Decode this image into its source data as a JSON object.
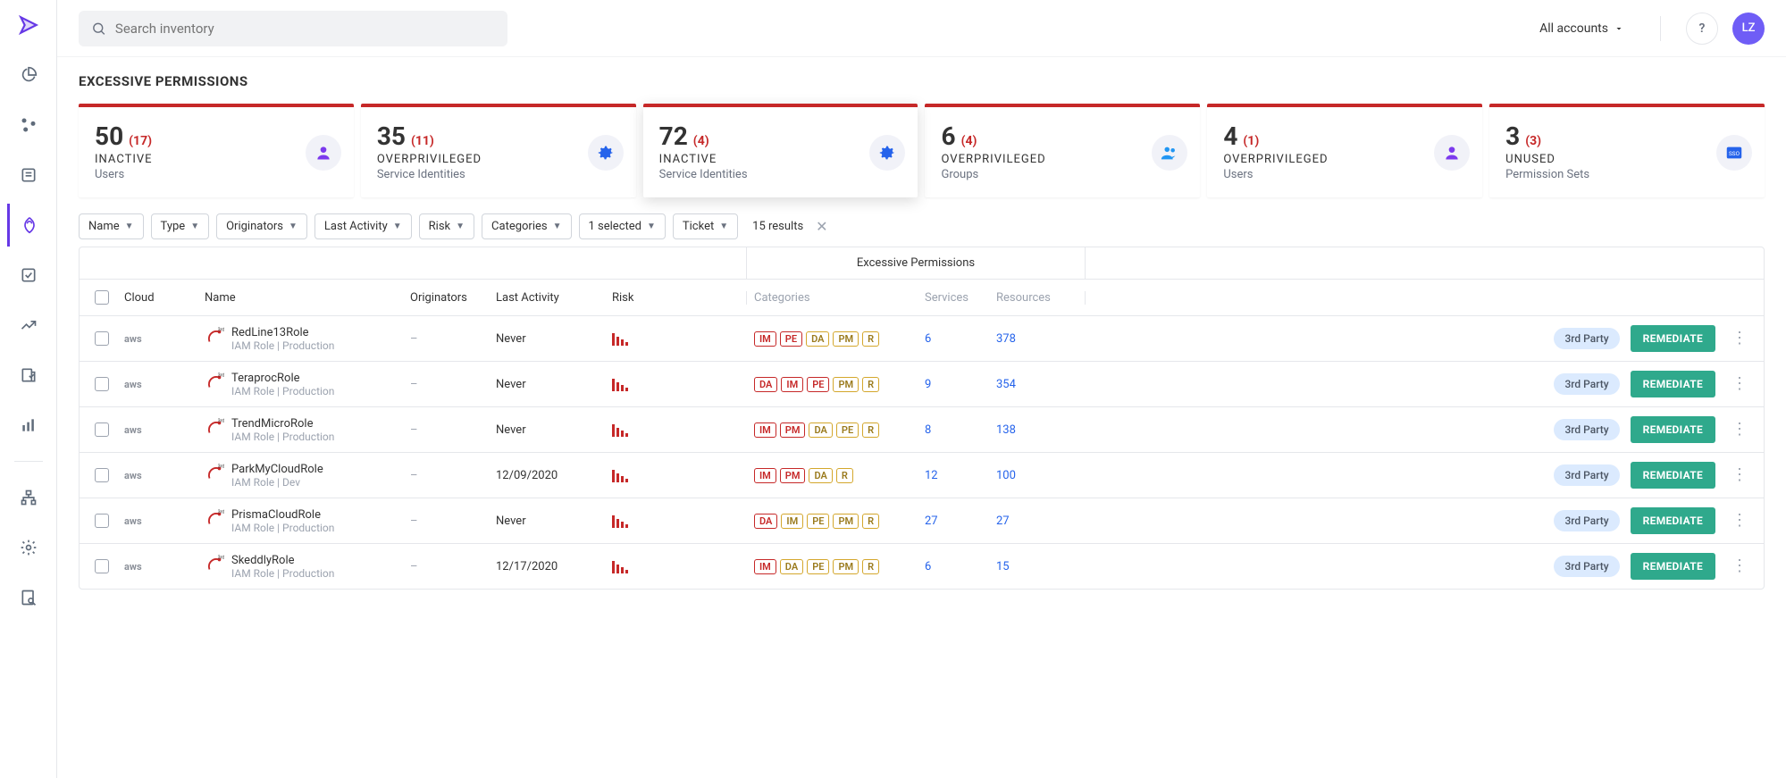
{
  "header": {
    "search_placeholder": "Search inventory",
    "account_selector": "All accounts",
    "help": "?",
    "avatar": "LZ"
  },
  "page": {
    "title": "EXCESSIVE PERMISSIONS"
  },
  "cards": [
    {
      "num": "50",
      "delta": "(17)",
      "label": "INACTIVE",
      "sub": "Users",
      "icon": "user"
    },
    {
      "num": "35",
      "delta": "(11)",
      "label": "OVERPRIVILEGED",
      "sub": "Service Identities",
      "icon": "gear"
    },
    {
      "num": "72",
      "delta": "(4)",
      "label": "INACTIVE",
      "sub": "Service Identities",
      "icon": "gear",
      "active": true
    },
    {
      "num": "6",
      "delta": "(4)",
      "label": "OVERPRIVILEGED",
      "sub": "Groups",
      "icon": "group"
    },
    {
      "num": "4",
      "delta": "(1)",
      "label": "OVERPRIVILEGED",
      "sub": "Users",
      "icon": "user"
    },
    {
      "num": "3",
      "delta": "(3)",
      "label": "UNUSED",
      "sub": "Permission Sets",
      "icon": "sso"
    }
  ],
  "filters": {
    "items": [
      "Name",
      "Type",
      "Originators",
      "Last Activity",
      "Risk",
      "Categories",
      "1 selected",
      "Ticket"
    ],
    "results": "15 results"
  },
  "table": {
    "group_header": "Excessive Permissions",
    "columns": {
      "cloud": "Cloud",
      "name": "Name",
      "orig": "Originators",
      "last": "Last Activity",
      "risk": "Risk",
      "cat": "Categories",
      "svc": "Services",
      "res": "Resources"
    },
    "cloud_label": "aws",
    "third_party_label": "3rd Party",
    "remediate_label": "REMEDIATE",
    "dash": "–",
    "rows": [
      {
        "name": "RedLine13Role",
        "meta": "IAM Role | Production",
        "last": "Never",
        "cats": [
          {
            "t": "IM",
            "c": "red"
          },
          {
            "t": "PE",
            "c": "red"
          },
          {
            "t": "DA",
            "c": "yel"
          },
          {
            "t": "PM",
            "c": "yel"
          },
          {
            "t": "R",
            "c": "yel"
          }
        ],
        "svc": "6",
        "res": "378"
      },
      {
        "name": "TeraprocRole",
        "meta": "IAM Role | Production",
        "last": "Never",
        "cats": [
          {
            "t": "DA",
            "c": "red"
          },
          {
            "t": "IM",
            "c": "red"
          },
          {
            "t": "PE",
            "c": "red"
          },
          {
            "t": "PM",
            "c": "yel"
          },
          {
            "t": "R",
            "c": "yel"
          }
        ],
        "svc": "9",
        "res": "354"
      },
      {
        "name": "TrendMicroRole",
        "meta": "IAM Role | Production",
        "last": "Never",
        "cats": [
          {
            "t": "IM",
            "c": "red"
          },
          {
            "t": "PM",
            "c": "red"
          },
          {
            "t": "DA",
            "c": "yel"
          },
          {
            "t": "PE",
            "c": "yel"
          },
          {
            "t": "R",
            "c": "yel"
          }
        ],
        "svc": "8",
        "res": "138"
      },
      {
        "name": "ParkMyCloudRole",
        "meta": "IAM Role | Dev",
        "last": "12/09/2020",
        "cats": [
          {
            "t": "IM",
            "c": "red"
          },
          {
            "t": "PM",
            "c": "red"
          },
          {
            "t": "DA",
            "c": "yel"
          },
          {
            "t": "R",
            "c": "yel"
          }
        ],
        "svc": "12",
        "res": "100"
      },
      {
        "name": "PrismaCloudRole",
        "meta": "IAM Role | Production",
        "last": "Never",
        "cats": [
          {
            "t": "DA",
            "c": "red"
          },
          {
            "t": "IM",
            "c": "yel"
          },
          {
            "t": "PE",
            "c": "yel"
          },
          {
            "t": "PM",
            "c": "yel"
          },
          {
            "t": "R",
            "c": "yel"
          }
        ],
        "svc": "27",
        "res": "27"
      },
      {
        "name": "SkeddlyRole",
        "meta": "IAM Role | Production",
        "last": "12/17/2020",
        "cats": [
          {
            "t": "IM",
            "c": "red"
          },
          {
            "t": "DA",
            "c": "yel"
          },
          {
            "t": "PE",
            "c": "yel"
          },
          {
            "t": "PM",
            "c": "yel"
          },
          {
            "t": "R",
            "c": "yel"
          }
        ],
        "svc": "6",
        "res": "15"
      }
    ]
  }
}
